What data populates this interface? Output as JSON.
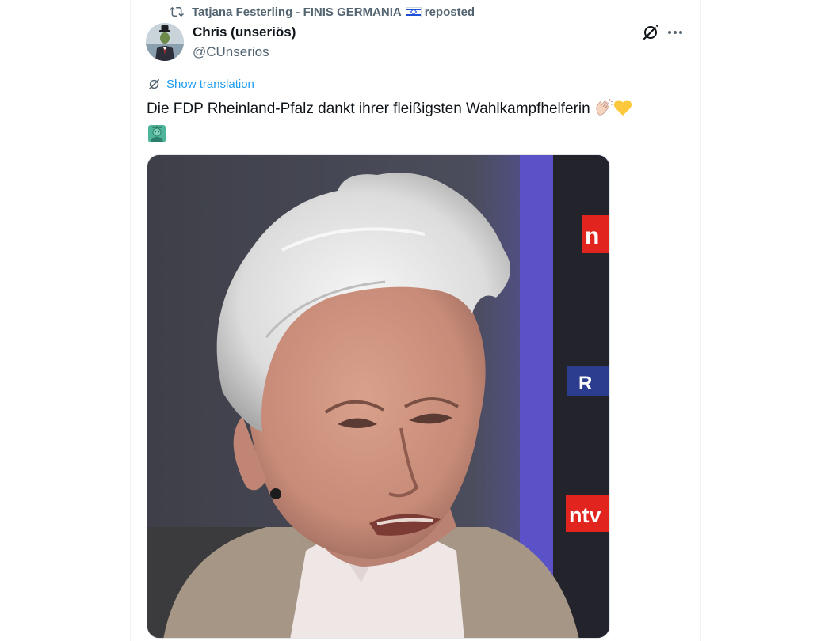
{
  "social_context": {
    "reposter": "Tatjana Festerling - FINIS GERMANIA",
    "action": "reposted",
    "flag_icon": "israel-flag-icon"
  },
  "author": {
    "display_name": "Chris (unseriös)",
    "handle": "@CUnserios"
  },
  "translate": {
    "label": "Show translation"
  },
  "tweet": {
    "text": "Die FDP Rheinland-Pfalz dankt ihrer fleißigsten Wahlkampfhelferin",
    "emojis": [
      "clapping-hands-emoji",
      "yellow-heart-emoji",
      "statue-of-liberty-emoji"
    ]
  },
  "media": {
    "background_letters": [
      "n",
      "R",
      "ntv"
    ],
    "colors": {
      "ntv_red": "#e2241f",
      "backdrop_purple": "#5b52c8",
      "backdrop_dark": "#22232b"
    }
  },
  "colors": {
    "text_primary": "#0f1419",
    "text_secondary": "#536471",
    "link_blue": "#1d9bf0"
  }
}
